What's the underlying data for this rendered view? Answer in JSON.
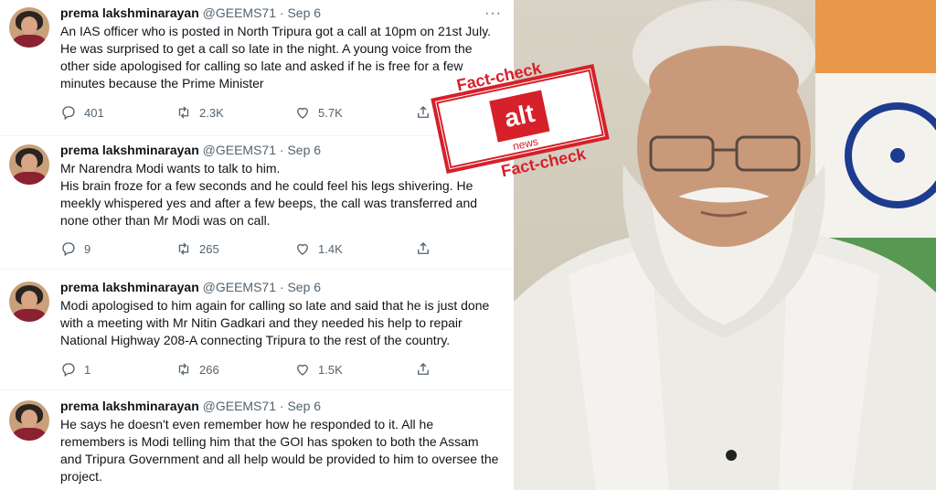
{
  "tweets": [
    {
      "name": "prema lakshminarayan",
      "handle": "@GEEMS71",
      "dot": "·",
      "date": "Sep 6",
      "more": "···",
      "text": "An IAS officer who is posted in North Tripura got a call at 10pm on 21st July. He was surprised to get a call so late in the night. A young voice from the other side apologised for calling so late and asked if he is free for a few minutes because the Prime Minister",
      "replies": "401",
      "retweets": "2.3K",
      "likes": "5.7K"
    },
    {
      "name": "prema lakshminarayan",
      "handle": "@GEEMS71",
      "dot": "·",
      "date": "Sep 6",
      "more": "",
      "text": "Mr Narendra Modi wants to talk to him.\nHis brain froze for a few seconds and he could feel his legs shivering. He meekly whispered yes and after a few beeps, the call was transferred and none other than Mr Modi was on call.",
      "replies": "9",
      "retweets": "265",
      "likes": "1.4K"
    },
    {
      "name": "prema lakshminarayan",
      "handle": "@GEEMS71",
      "dot": "·",
      "date": "Sep 6",
      "more": "",
      "text": "Modi apologised to him again for calling so late and said that he is just done with a meeting with Mr Nitin Gadkari and they needed his help to repair National Highway 208-A connecting Tripura to the rest of the country.",
      "replies": "1",
      "retweets": "266",
      "likes": "1.5K"
    },
    {
      "name": "prema lakshminarayan",
      "handle": "@GEEMS71",
      "dot": "·",
      "date": "Sep 6",
      "more": "",
      "text": "He says he doesn't even remember how he responded to it. All he remembers is Modi telling him that the GOI has spoken to both the Assam and Tripura Government and all help would be provided to him to oversee the project."
    }
  ],
  "stamp": {
    "top_text": "Fact-check",
    "logo_main": "alt",
    "logo_sub": "news",
    "bottom_text": "Fact-check"
  },
  "colors": {
    "text": "#0f1419",
    "muted": "#536471",
    "stamp_red": "#d6202a"
  }
}
